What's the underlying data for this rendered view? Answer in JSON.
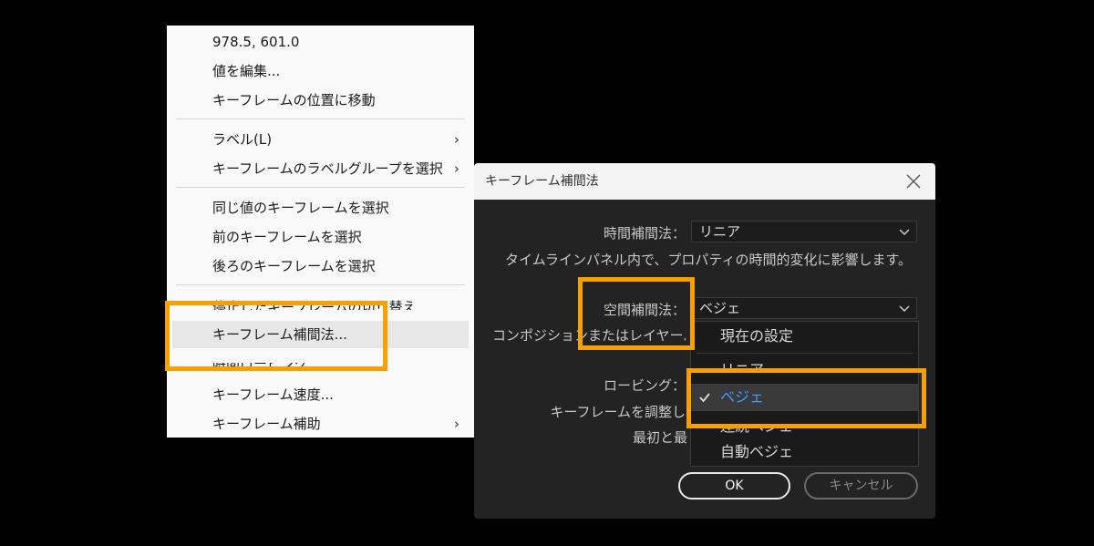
{
  "context_menu": {
    "items": [
      {
        "label": "978.5, 601.0"
      },
      {
        "label": "値を編集..."
      },
      {
        "label": "キーフレームの位置に移動"
      },
      {
        "label": "ラベル(L)"
      },
      {
        "label": "キーフレームのラベルグループを選択"
      },
      {
        "label": "同じ値のキーフレームを選択"
      },
      {
        "label": "前のキーフレームを選択"
      },
      {
        "label": "後ろのキーフレームを選択"
      },
      {
        "label": "停止したキーフレームの切り替え"
      },
      {
        "label": "キーフレーム補間法..."
      },
      {
        "label": "時間ロービング"
      },
      {
        "label": "キーフレーム速度..."
      },
      {
        "label": "キーフレーム補助"
      }
    ]
  },
  "dialog": {
    "title": "キーフレーム補間法",
    "temporal_label": "時間補間法：",
    "temporal_value": "リニア",
    "temporal_desc": "タイムラインパネル内で、プロパティの時間的変化に影響します。",
    "spatial_label": "空間補間法：",
    "spatial_value": "ベジェ",
    "spatial_desc": "コンポジションまたはレイヤーパネル内",
    "roving_label": "ロービング：",
    "roving_desc": "キーフレームを調整し",
    "roving_desc2": "最初と最",
    "ok_label": "OK",
    "cancel_label": "キャンセル"
  },
  "dropdown": {
    "items": [
      {
        "label": "現在の設定"
      },
      {
        "label": "リニア"
      },
      {
        "label": "ベジェ",
        "selected": true
      },
      {
        "label": "連続ベジェ"
      },
      {
        "label": "自動ベジェ"
      }
    ]
  },
  "colors": {
    "highlight": "#f6a100",
    "selected_text": "#3f9bff",
    "dialog_bg": "#232323",
    "menu_bg": "#f9f9f9"
  }
}
